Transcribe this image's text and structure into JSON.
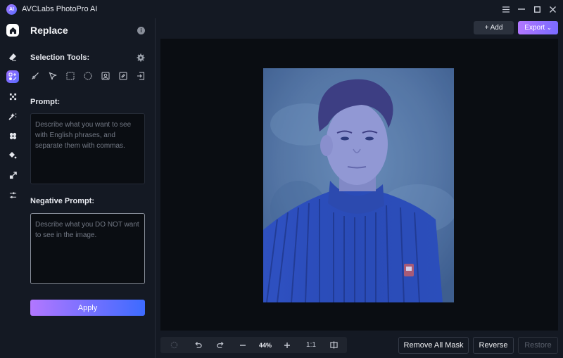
{
  "app": {
    "title": "AVCLabs PhotoPro AI",
    "logo_text": "AI"
  },
  "window_controls": {
    "menu": "☰",
    "minimize": "—",
    "maximize": "☐",
    "close": "✕"
  },
  "rail": {
    "items": [
      {
        "name": "home",
        "icon": "home-icon"
      },
      {
        "name": "erase",
        "icon": "eraser-icon"
      },
      {
        "name": "replace",
        "icon": "replace-icon",
        "active": true
      },
      {
        "name": "crop",
        "icon": "expand-icon"
      },
      {
        "name": "colorize",
        "icon": "magic-icon"
      },
      {
        "name": "effects",
        "icon": "flower-icon"
      },
      {
        "name": "fill",
        "icon": "paint-bucket-icon"
      },
      {
        "name": "upscale",
        "icon": "upscale-icon"
      },
      {
        "name": "adjust",
        "icon": "sliders-icon"
      }
    ]
  },
  "panel": {
    "title": "Replace",
    "selection_tools_label": "Selection Tools:",
    "tools": [
      "brush",
      "lasso",
      "rectangle",
      "ellipse",
      "portrait",
      "background",
      "import"
    ],
    "prompt_label": "Prompt:",
    "prompt_value": "",
    "prompt_placeholder": "Describe what you want to see with English phrases, and separate them with commas.",
    "negative_label": "Negative Prompt:",
    "negative_value": "",
    "negative_placeholder": "Describe what you DO NOT want to see in the image.",
    "apply_label": "Apply"
  },
  "toolbar": {
    "add_label": "+ Add",
    "export_label": "Export",
    "export_chevron": "⌄"
  },
  "zoombar": {
    "zoom": "44%",
    "one_to_one": "1:1"
  },
  "bottom": {
    "remove_all_mask": "Remove All Mask",
    "reverse": "Reverse",
    "restore": "Restore"
  },
  "colors": {
    "accent_start": "#b277ff",
    "accent_end": "#3d6bff",
    "mask_tint": "#3a5fd8"
  }
}
